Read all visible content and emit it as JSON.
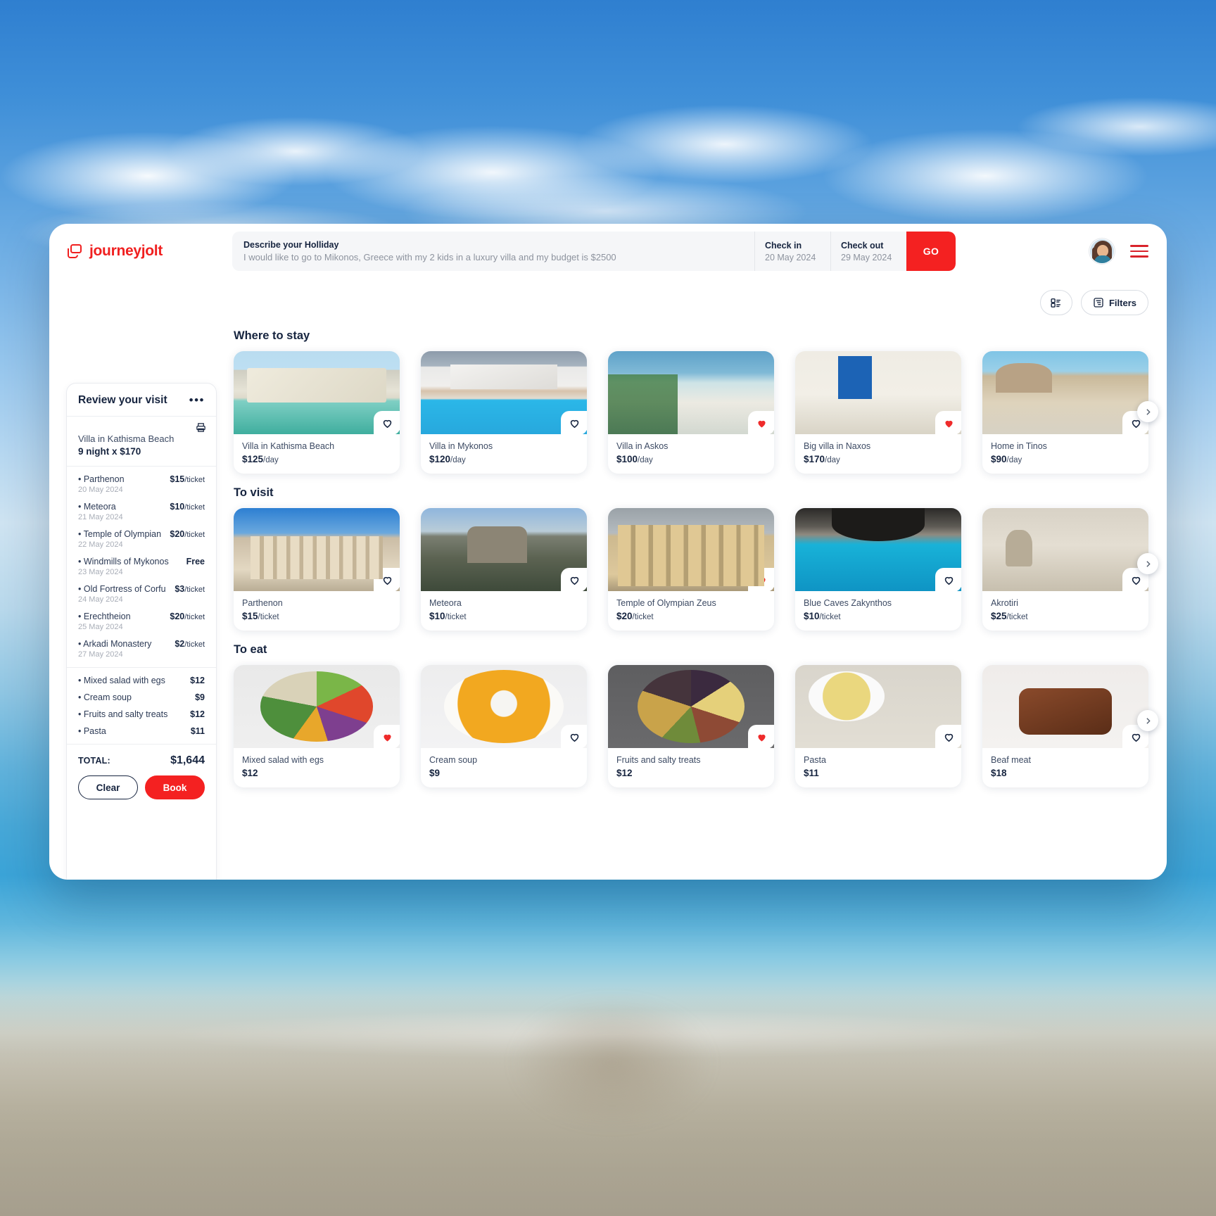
{
  "brand": {
    "name": "journeyjolt",
    "icon": "logo-icon"
  },
  "search": {
    "describe_label": "Describe your Holliday",
    "describe_value": "I would like to go to Mikonos, Greece with my 2 kids in a luxury villa and my budget is $2500",
    "checkin_label": "Check in",
    "checkin_value": "20 May 2024",
    "checkout_label": "Check out",
    "checkout_value": "29 May 2024",
    "go_label": "GO"
  },
  "toolbar": {
    "view_toggle_icon": "list-view-icon",
    "filters_label": "Filters",
    "filters_icon": "filter-icon"
  },
  "sidebar": {
    "title": "Review your visit",
    "menu_icon": "more-options-icon",
    "print_icon": "print-icon",
    "stay_name": "Villa in Kathisma Beach",
    "stay_nights": "9 night x $170",
    "visits": [
      {
        "name": "Parthenon",
        "price": "$15",
        "unit": "/ticket",
        "date": "20 May 2024"
      },
      {
        "name": "Meteora",
        "price": "$10",
        "unit": "/ticket",
        "date": "21 May 2024"
      },
      {
        "name": "Temple of Olympian",
        "price": "$20",
        "unit": "/ticket",
        "date": "22 May 2024"
      },
      {
        "name": "Windmills of Mykonos",
        "price": "Free",
        "unit": "",
        "date": "23 May 2024"
      },
      {
        "name": "Old Fortress of Corfu",
        "price": "$3",
        "unit": "/ticket",
        "date": "24 May 2024"
      },
      {
        "name": "Erechtheion",
        "price": "$20",
        "unit": "/ticket",
        "date": "25 May 2024"
      },
      {
        "name": "Arkadi Monastery",
        "price": "$2",
        "unit": "/ticket",
        "date": "27 May 2024"
      }
    ],
    "foods": [
      {
        "name": "Mixed salad with egs",
        "price": "$12"
      },
      {
        "name": "Cream soup",
        "price": "$9"
      },
      {
        "name": "Fruits and salty treats",
        "price": "$12"
      },
      {
        "name": "Pasta",
        "price": "$11"
      }
    ],
    "total_label": "TOTAL:",
    "total_value": "$1,644",
    "clear_label": "Clear",
    "book_label": "Book"
  },
  "sections": [
    {
      "title": "Where to stay",
      "cards": [
        {
          "name": "Villa in Kathisma Beach",
          "price": "$125",
          "unit": "/day",
          "favorited": false,
          "photo": "ph-villa1"
        },
        {
          "name": "Villa in Mykonos",
          "price": "$120",
          "unit": "/day",
          "favorited": false,
          "photo": "ph-villa2"
        },
        {
          "name": "Villa in Askos",
          "price": "$100",
          "unit": "/day",
          "favorited": true,
          "photo": "ph-villa3"
        },
        {
          "name": "Big villa in Naxos",
          "price": "$170",
          "unit": "/day",
          "favorited": true,
          "photo": "ph-villa4"
        },
        {
          "name": "Home in Tinos",
          "price": "$90",
          "unit": "/day",
          "favorited": false,
          "photo": "ph-villa5"
        }
      ]
    },
    {
      "title": "To visit",
      "cards": [
        {
          "name": "Parthenon",
          "price": "$15",
          "unit": "/ticket",
          "favorited": false,
          "photo": "ph-parth"
        },
        {
          "name": "Meteora",
          "price": "$10",
          "unit": "/ticket",
          "favorited": false,
          "photo": "ph-meteora"
        },
        {
          "name": "Temple of Olympian Zeus",
          "price": "$20",
          "unit": "/ticket",
          "favorited": true,
          "photo": "ph-zeus"
        },
        {
          "name": "Blue Caves Zakynthos",
          "price": "$10",
          "unit": "/ticket",
          "favorited": false,
          "photo": "ph-caves"
        },
        {
          "name": "Akrotiri",
          "price": "$25",
          "unit": "/ticket",
          "favorited": false,
          "photo": "ph-akrotiri"
        }
      ]
    },
    {
      "title": "To eat",
      "cards": [
        {
          "name": "Mixed salad with egs",
          "price": "$12",
          "unit": "",
          "favorited": true,
          "photo": "ph-salad"
        },
        {
          "name": "Cream soup",
          "price": "$9",
          "unit": "",
          "favorited": false,
          "photo": "ph-soup"
        },
        {
          "name": "Fruits and salty treats",
          "price": "$12",
          "unit": "",
          "favorited": true,
          "photo": "ph-fruits"
        },
        {
          "name": "Pasta",
          "price": "$11",
          "unit": "",
          "favorited": false,
          "photo": "ph-pasta"
        },
        {
          "name": "Beaf meat",
          "price": "$18",
          "unit": "",
          "favorited": false,
          "photo": "ph-beef"
        }
      ]
    }
  ],
  "colors": {
    "accent": "#f42121",
    "text_dark": "#16243f",
    "muted": "#8d939e"
  }
}
